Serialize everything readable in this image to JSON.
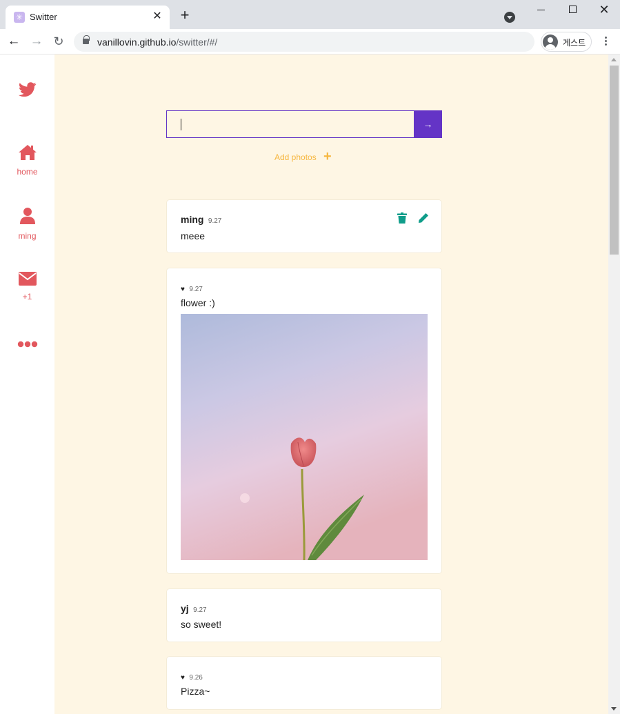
{
  "browser": {
    "tab_title": "Switter",
    "favicon_glyph": "✳",
    "close_glyph": "✕",
    "new_tab_glyph": "+",
    "back_glyph": "←",
    "forward_glyph": "→",
    "reload_glyph": "↻",
    "window_close_glyph": "✕",
    "url_host": "vanillovin.github.io",
    "url_path": "/switter/#/",
    "profile_label": "게스트"
  },
  "sidebar": {
    "items": [
      {
        "icon": "twitter-icon",
        "label": ""
      },
      {
        "icon": "home-icon",
        "label": "home"
      },
      {
        "icon": "user-icon",
        "label": "ming"
      },
      {
        "icon": "mail-icon",
        "label": "+1"
      },
      {
        "icon": "more-icon",
        "label": ""
      }
    ]
  },
  "composer": {
    "input_value": "",
    "submit_glyph": "→",
    "add_photos_label": "Add photos",
    "add_photos_glyph": "+"
  },
  "tweets": [
    {
      "author": "ming",
      "date": "9.27",
      "text": "meee",
      "has_actions": true
    },
    {
      "author": "",
      "heart": "♥",
      "date": "9.27",
      "text": "flower :)",
      "has_photo": true
    },
    {
      "author": "yj",
      "date": "9.27",
      "text": "so sweet!"
    },
    {
      "author": "",
      "heart": "♥",
      "date": "9.26",
      "text": "Pizza~"
    }
  ],
  "colors": {
    "main_background": "#fef6e4",
    "accent": "#6434c6",
    "sidebar_icon": "#e2575d",
    "add_photos": "#f6b741",
    "action_icon": "#0f9d8a"
  }
}
